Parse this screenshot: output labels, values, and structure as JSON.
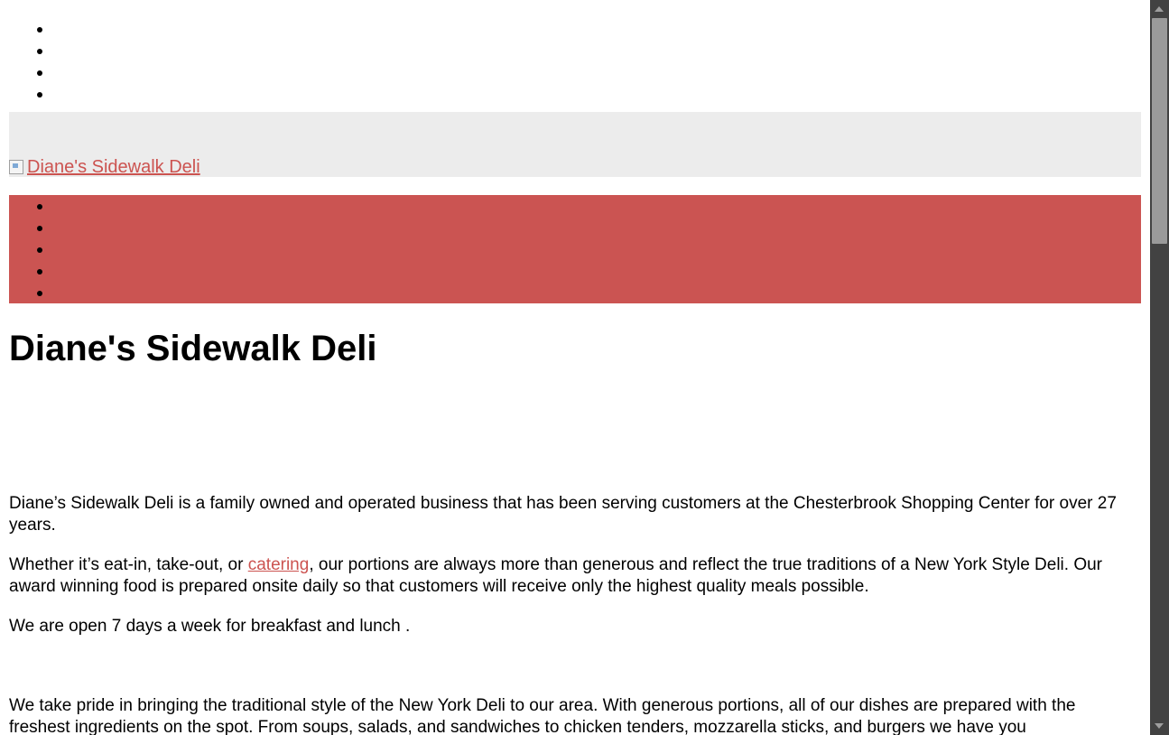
{
  "top_menu": {
    "items": [
      "",
      "",
      "",
      ""
    ]
  },
  "header": {
    "logo_alt": "Diane's Sidewalk Deli"
  },
  "nav": {
    "items": [
      "",
      "",
      "",
      "",
      ""
    ]
  },
  "main": {
    "title": "Diane's Sidewalk Deli",
    "para1": "Diane’s Sidewalk Deli is a family owned and operated business that has been serving customers at the Chesterbrook Shopping Center for over 27 years.",
    "para2_before": "Whether it’s eat-in, take-out, or ",
    "para2_link": "catering",
    "para2_after": ", our portions are always more than generous and reflect the true traditions of a New York Style Deli. Our award winning food is prepared onsite daily so that customers will receive only the highest quality meals possible.",
    "para3": "We are open 7 days a week for breakfast and lunch .",
    "para4": "We take pride in bringing the traditional style of the New York Deli to our area. With generous portions, all of our dishes are prepared with the freshest ingredients on the spot. From soups, salads, and sandwiches to chicken tenders, mozzarella sticks, and burgers we have you"
  },
  "colors": {
    "nav_bg": "#cb5452",
    "header_bg": "#ececec",
    "link": "#cc5350"
  }
}
